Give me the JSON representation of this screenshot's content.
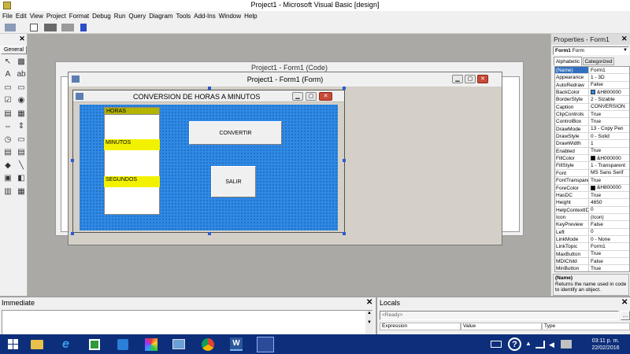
{
  "app": {
    "title": "Project1 - Microsoft Visual Basic [design]"
  },
  "menu": [
    "File",
    "Edit",
    "View",
    "Project",
    "Format",
    "Debug",
    "Run",
    "Query",
    "Diagram",
    "Tools",
    "Add-Ins",
    "Window",
    "Help"
  ],
  "toolbox": {
    "tab": "General"
  },
  "code_window": {
    "title": "Project1 - Form1 (Code)"
  },
  "designer": {
    "title": "Project1 - Form1 (Form)"
  },
  "form": {
    "caption": "CONVERSION DE HORAS A MINUTOS",
    "labels": [
      "HORAS",
      "MINUTOS",
      "SEGUNDOS"
    ],
    "buttons": {
      "convert": "CONVERTIR",
      "exit": "SALIR"
    }
  },
  "properties": {
    "title": "Properties - Form1",
    "object": "Form1",
    "object_type": "Form",
    "tabs": [
      "Alphabetic",
      "Categorized"
    ],
    "rows": [
      [
        "(Name)",
        "Form1"
      ],
      [
        "Appearance",
        "1 - 3D"
      ],
      [
        "AutoRedraw",
        "False"
      ],
      [
        "BackColor",
        "&H800000"
      ],
      [
        "BorderStyle",
        "2 - Sizable"
      ],
      [
        "Caption",
        "CONVERSION"
      ],
      [
        "ClipControls",
        "True"
      ],
      [
        "ControlBox",
        "True"
      ],
      [
        "DrawMode",
        "13 - Copy Pen"
      ],
      [
        "DrawStyle",
        "0 - Solid"
      ],
      [
        "DrawWidth",
        "1"
      ],
      [
        "Enabled",
        "True"
      ],
      [
        "FillColor",
        "&H000000"
      ],
      [
        "FillStyle",
        "1 - Transparent"
      ],
      [
        "Font",
        "MS Sans Serif"
      ],
      [
        "FontTransparent",
        "True"
      ],
      [
        "ForeColor",
        "&H800000"
      ],
      [
        "HasDC",
        "True"
      ],
      [
        "Height",
        "4650"
      ],
      [
        "HelpContextID",
        "0"
      ],
      [
        "Icon",
        "(Icon)"
      ],
      [
        "KeyPreview",
        "False"
      ],
      [
        "Left",
        "0"
      ],
      [
        "LinkMode",
        "0 - None"
      ],
      [
        "LinkTopic",
        "Form1"
      ],
      [
        "MaxButton",
        "True"
      ],
      [
        "MDIChild",
        "False"
      ],
      [
        "MinButton",
        "True"
      ]
    ],
    "desc_title": "(Name)",
    "desc_text": "Returns the name used in code to identify an object."
  },
  "immediate": {
    "title": "Immediate"
  },
  "locals": {
    "title": "Locals",
    "status": "<Ready>",
    "columns": [
      "Expression",
      "Value",
      "Type"
    ]
  },
  "taskbar": {
    "time": "03:11 p. m.",
    "date": "22/02/2016"
  },
  "colors": {
    "form_bg": "#2f89e6",
    "label_bg": "#f2f200",
    "selected_row": "#3170c0",
    "titlebar": "#ffffff"
  }
}
